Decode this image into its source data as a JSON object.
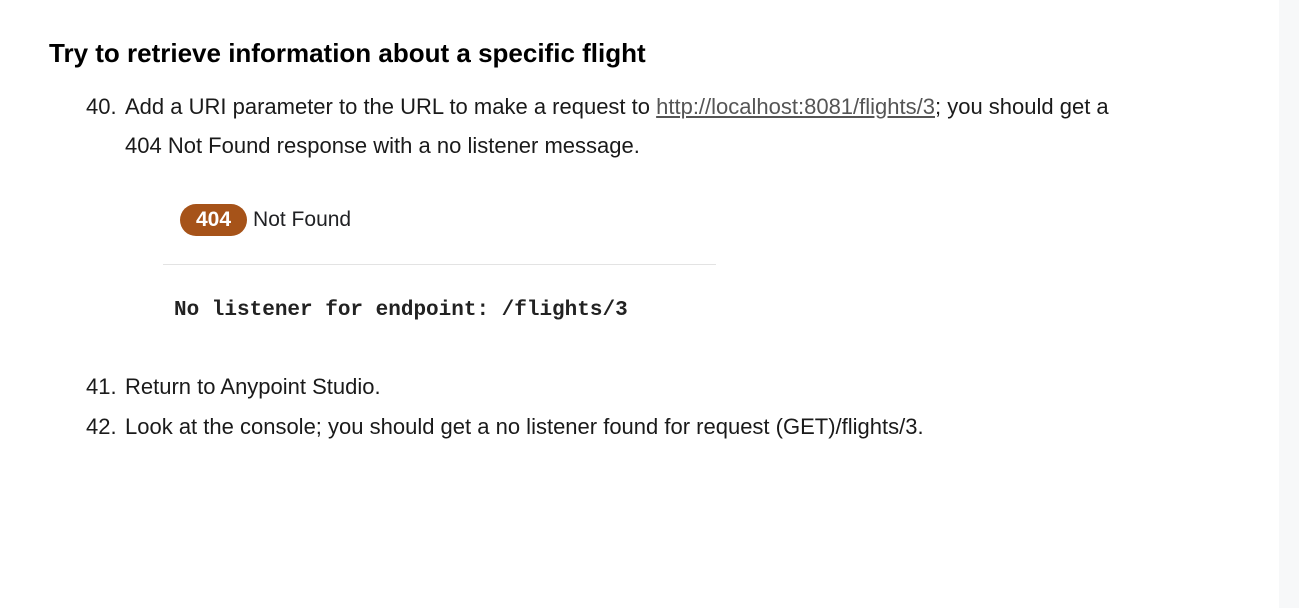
{
  "heading": "Try to retrieve information about a specific flight",
  "steps": [
    {
      "number": "40.",
      "text_before": "Add a URI parameter to the URL to make a request to ",
      "link": "http://localhost:8081/flights/3",
      "text_after_link": "; you should get a",
      "text_line2": "404 Not Found response with a no listener message."
    },
    {
      "number": "41.",
      "text": "Return to Anypoint Studio."
    },
    {
      "number": "42.",
      "text": "Look at the console; you should get a no listener found for request (GET)/flights/3."
    }
  ],
  "response": {
    "status_code": "404",
    "status_text": "Not Found",
    "body": "No listener for endpoint: /flights/3",
    "badge_color": "#a65319"
  }
}
